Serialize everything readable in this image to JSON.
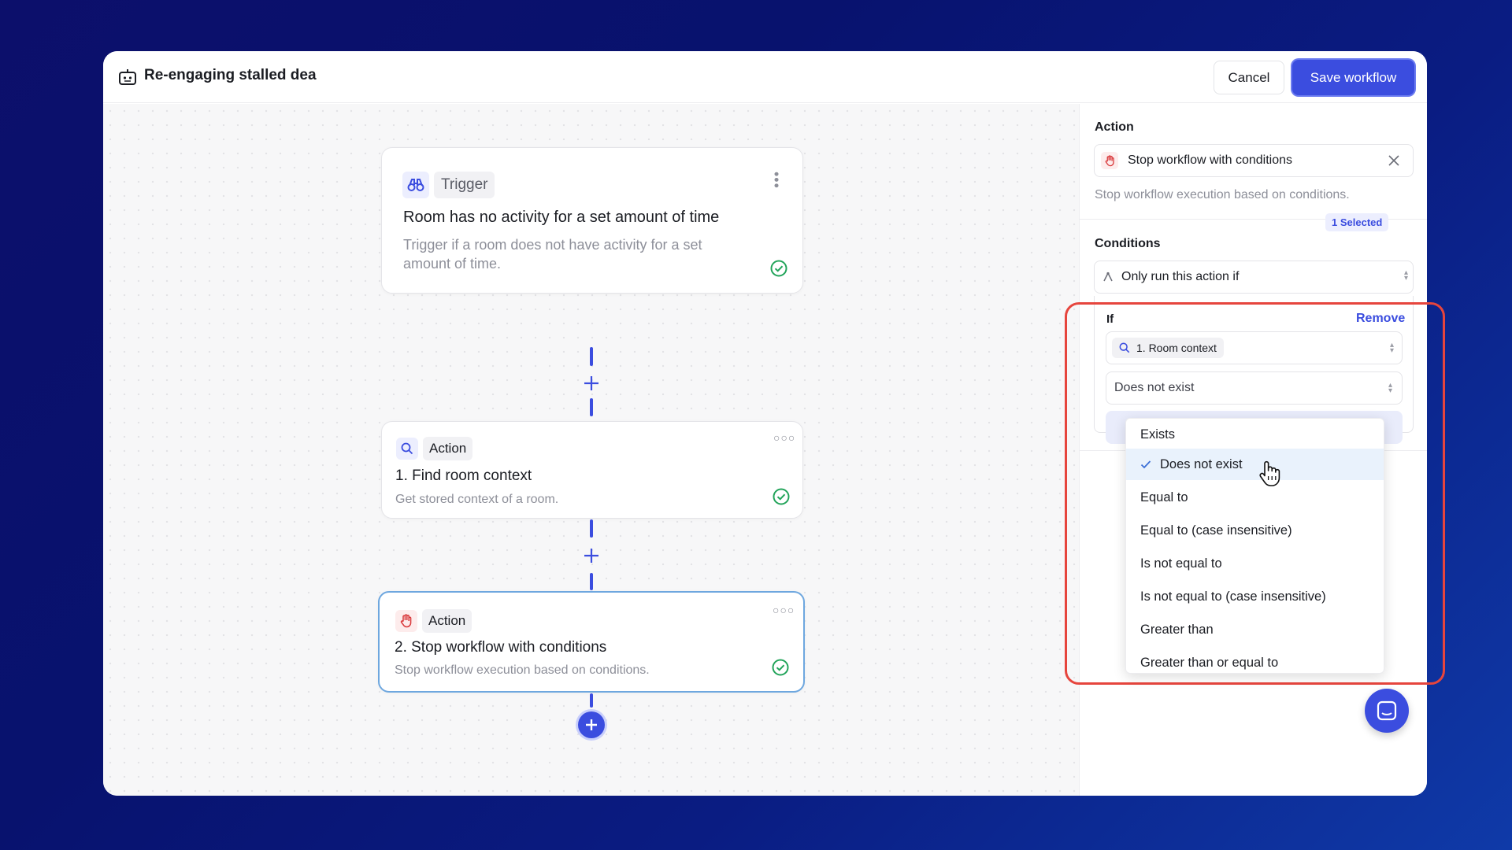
{
  "header": {
    "title": "Re-engaging stalled dea",
    "cancel_label": "Cancel",
    "save_label": "Save workflow"
  },
  "nodes": [
    {
      "tag": "Trigger",
      "title": "Room has no activity for a set amount of time",
      "description": "Trigger if a room does not have activity for a set amount of time.",
      "icon": "binoculars-icon"
    },
    {
      "tag": "Action",
      "title": "1. Find room context",
      "description": "Get stored context of a room.",
      "icon": "search-icon"
    },
    {
      "tag": "Action",
      "title": "2. Stop workflow with conditions",
      "description": "Stop workflow execution based on conditions.",
      "icon": "hand-stop-icon"
    }
  ],
  "panel": {
    "action_label": "Action",
    "action_value": "Stop workflow with conditions",
    "action_description": "Stop workflow execution based on conditions.",
    "conditions_label": "Conditions",
    "conditions_select": "Only run this action if",
    "selected_badge": "1 Selected",
    "if_label": "If",
    "remove_label": "Remove",
    "source_value": "1. Room context",
    "operator_value": "Does not exist"
  },
  "dropdown": {
    "options": [
      "Exists",
      "Does not exist",
      "Equal to",
      "Equal to (case insensitive)",
      "Is not equal to",
      "Is not equal to (case insensitive)",
      "Greater than",
      "Greater than or equal to"
    ],
    "selected": "Does not exist"
  },
  "colors": {
    "accent": "#3b4ddf",
    "success": "#22a45a",
    "highlight": "#e6453d"
  }
}
